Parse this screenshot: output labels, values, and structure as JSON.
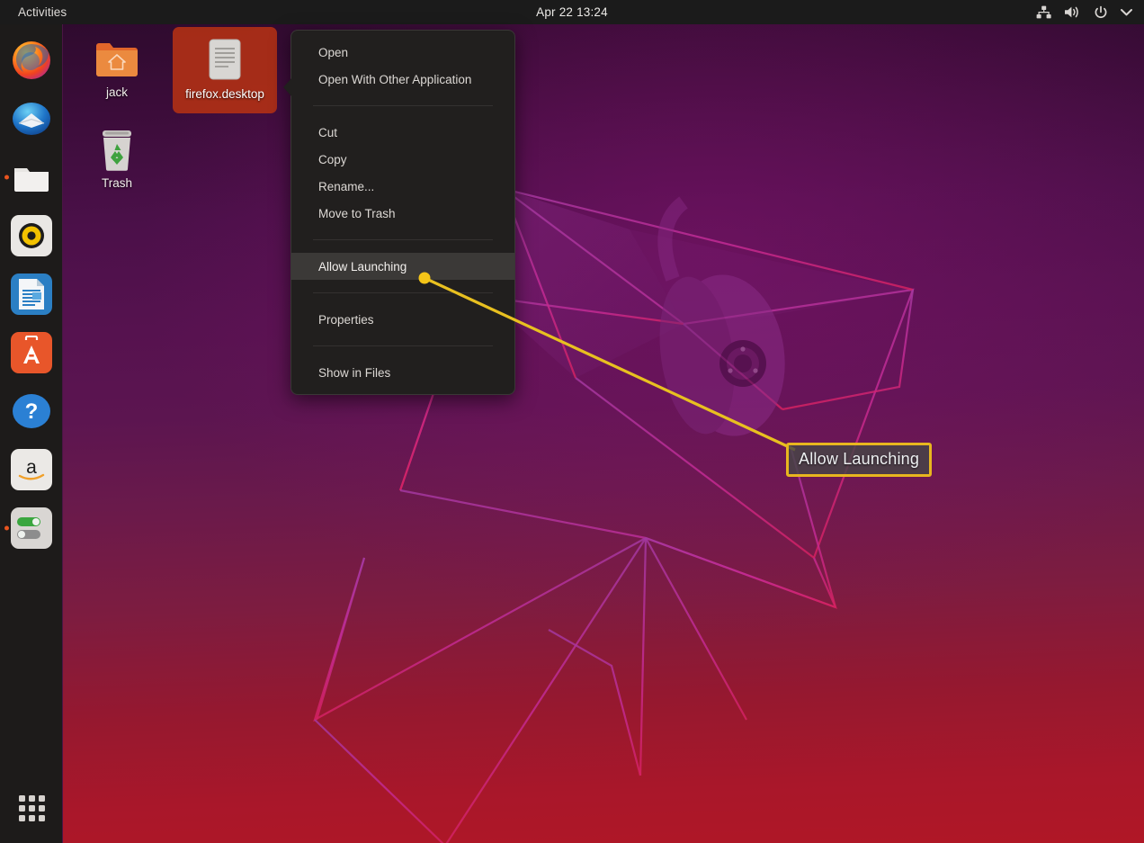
{
  "topbar": {
    "activities": "Activities",
    "clock": "Apr 22  13:24",
    "tray": [
      {
        "name": "network-icon",
        "label": "Network"
      },
      {
        "name": "volume-icon",
        "label": "Volume"
      },
      {
        "name": "power-icon",
        "label": "Power"
      },
      {
        "name": "chevron-down-icon",
        "label": "System menu"
      }
    ]
  },
  "dock": {
    "items": [
      {
        "name": "dock-item-firefox",
        "label": "Firefox Web Browser",
        "running": false
      },
      {
        "name": "dock-item-thunderbird",
        "label": "Thunderbird Mail",
        "running": false
      },
      {
        "name": "dock-item-files",
        "label": "Files",
        "running": true
      },
      {
        "name": "dock-item-rhythmbox",
        "label": "Rhythmbox",
        "running": false
      },
      {
        "name": "dock-item-libreoffice-writer",
        "label": "LibreOffice Writer",
        "running": false
      },
      {
        "name": "dock-item-ubuntu-software",
        "label": "Ubuntu Software",
        "running": false
      },
      {
        "name": "dock-item-help",
        "label": "Help",
        "running": false
      },
      {
        "name": "dock-item-amazon",
        "label": "Amazon",
        "running": false
      },
      {
        "name": "dock-item-settings",
        "label": "Settings",
        "running": true
      }
    ],
    "show_applications": "Show Applications"
  },
  "desktop": {
    "icons": [
      {
        "name": "desktop-icon-home",
        "label": "jack",
        "type": "home-folder",
        "selected": false
      },
      {
        "name": "desktop-icon-firefox-desktop",
        "label": "firefox.desktop",
        "type": "text-file",
        "selected": true
      },
      {
        "name": "desktop-icon-trash",
        "label": "Trash",
        "type": "trash",
        "selected": false
      }
    ]
  },
  "context_menu": {
    "items": [
      {
        "label": "Open",
        "highlighted": false
      },
      {
        "label": "Open With Other Application",
        "highlighted": false
      },
      {
        "label": "Cut",
        "highlighted": false
      },
      {
        "label": "Copy",
        "highlighted": false
      },
      {
        "label": "Rename...",
        "highlighted": false
      },
      {
        "label": "Move to Trash",
        "highlighted": false
      },
      {
        "label": "Allow Launching",
        "highlighted": true
      },
      {
        "label": "Properties",
        "highlighted": false
      },
      {
        "label": "Show in Files",
        "highlighted": false
      }
    ]
  },
  "annotation": {
    "callout_label": "Allow Launching",
    "accent_color": "#e8b61f",
    "dot_color": "#f5c518"
  },
  "colors": {
    "topbar_bg": "#1b1b1b",
    "dock_bg": "#1d1b1a",
    "menu_bg": "#211f1e",
    "menu_highlight": "#3b3937",
    "selection_bg": "#af3016",
    "wallpaper_top": "#2b0a2b",
    "wallpaper_bottom": "#b01726"
  }
}
